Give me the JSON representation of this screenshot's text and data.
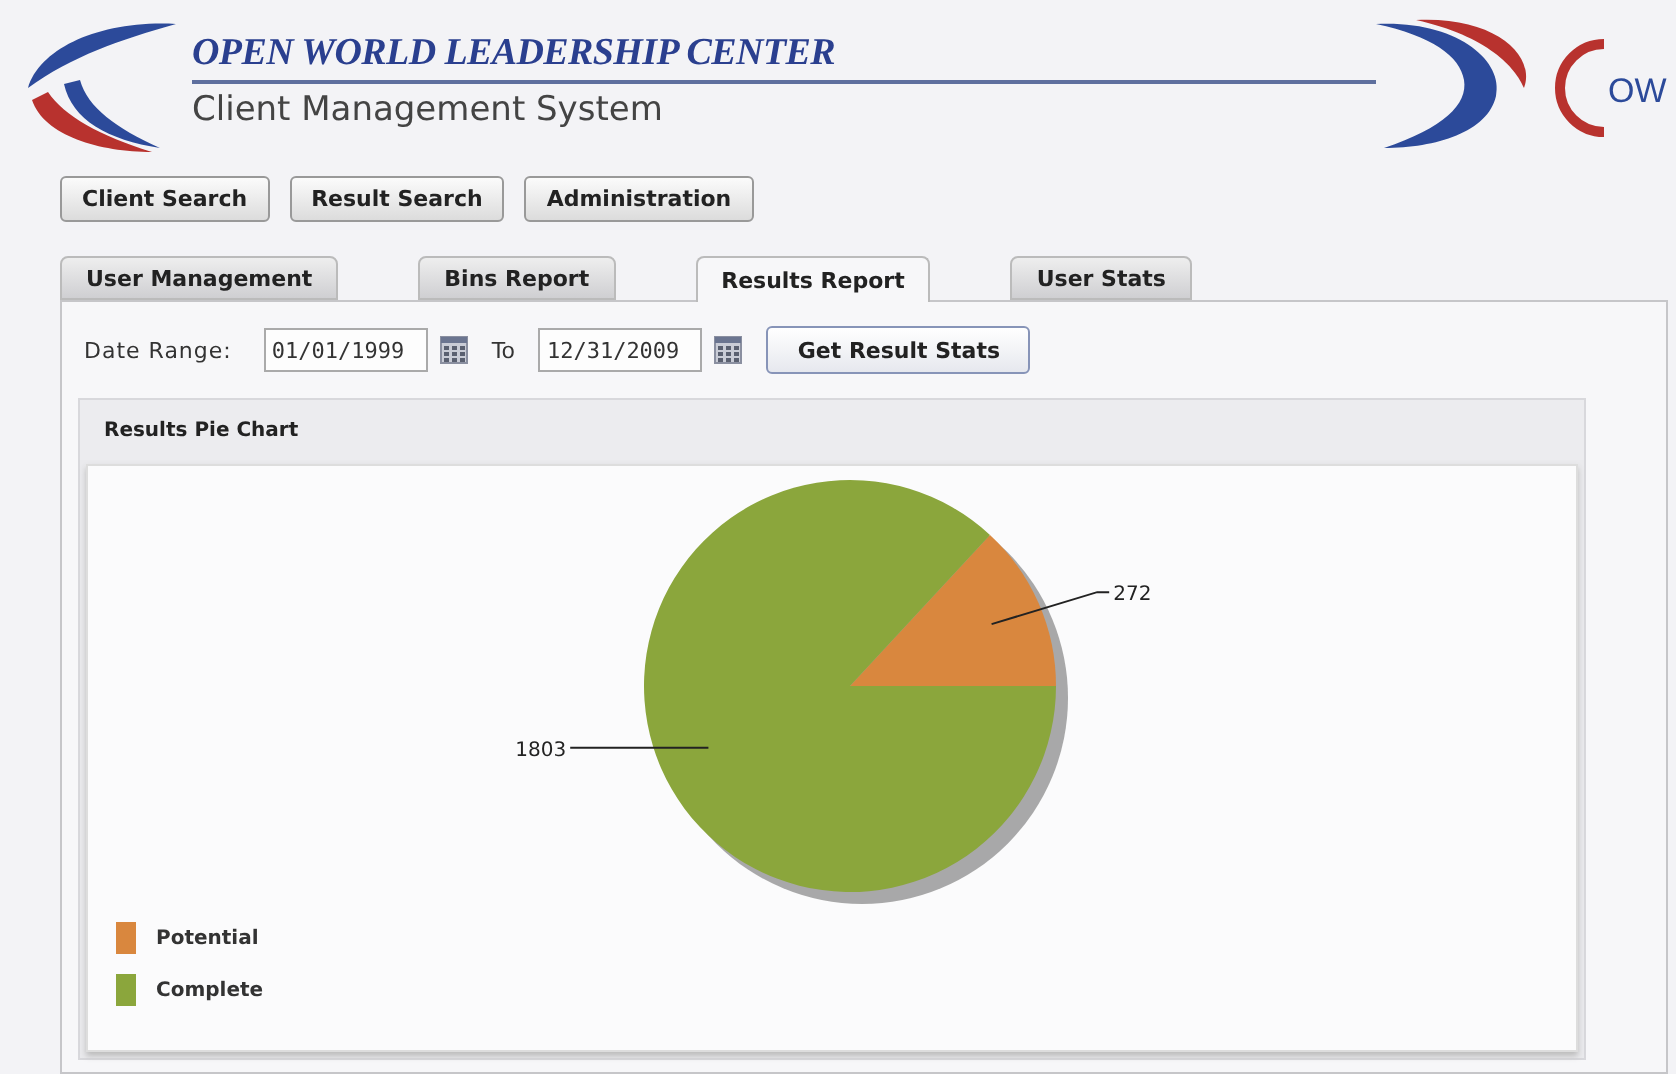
{
  "header": {
    "title": "OPEN WORLD LEADERSHIP CENTER",
    "subtitle": "Client Management System",
    "logo_text": "OW"
  },
  "nav_buttons": [
    "Client Search",
    "Result Search",
    "Administration"
  ],
  "tabs": [
    {
      "label": "User Management",
      "selected": false
    },
    {
      "label": "Bins Report",
      "selected": false
    },
    {
      "label": "Results Report",
      "selected": true
    },
    {
      "label": "User Stats",
      "selected": false
    }
  ],
  "date_range": {
    "label": "Date Range:",
    "from": "01/01/1999",
    "to_label": "To",
    "to": "12/31/2009",
    "button": "Get Result Stats"
  },
  "chart_panel": {
    "title": "Results Pie Chart",
    "chart_data": {
      "type": "pie",
      "categories": [
        "Potential",
        "Complete"
      ],
      "values": [
        272,
        1803
      ],
      "data_labels": true
    },
    "legend": [
      {
        "color": "#d9873e"
      },
      {
        "color": "#8ba63c"
      }
    ]
  }
}
